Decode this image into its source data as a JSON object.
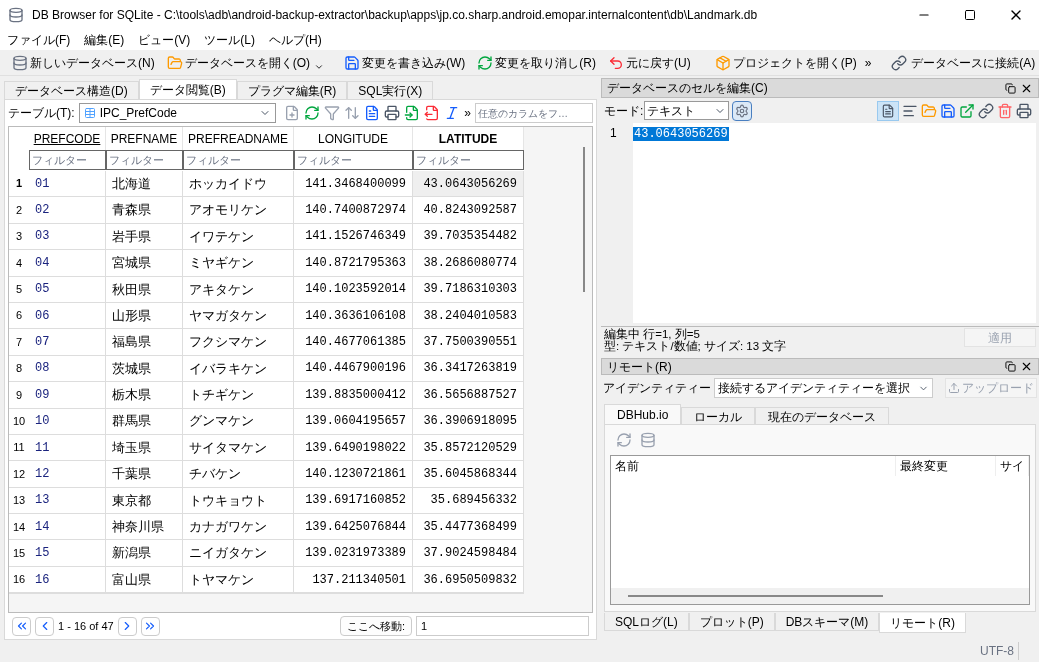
{
  "window": {
    "title": "DB Browser for SQLite - C:\\tools\\adb\\android-backup-extractor\\backup\\apps\\jp.co.sharp.android.emopar.internalcontent\\db\\Landmark.db"
  },
  "menu": [
    "ファイル(F)",
    "編集(E)",
    "ビュー(V)",
    "ツール(L)",
    "ヘルプ(H)"
  ],
  "toolbar": [
    {
      "label": "新しいデータベース(N)",
      "kind": "new"
    },
    {
      "label": "データベースを開く(O)",
      "kind": "open"
    },
    {
      "label": "変更を書き込み(W)",
      "kind": "write"
    },
    {
      "label": "変更を取り消し(R)",
      "kind": "revert"
    },
    {
      "label": "元に戻す(U)",
      "kind": "undo"
    },
    {
      "label": "プロジェクトを開く(P)",
      "kind": "project"
    }
  ],
  "toolbar_overflow": "»",
  "toolbar_connect": "データベースに接続(A)",
  "left_tabs": [
    {
      "label": "データベース構造(D)",
      "selected": false
    },
    {
      "label": "データ閲覧(B)",
      "selected": true
    },
    {
      "label": "プラグマ編集(R)",
      "selected": false
    },
    {
      "label": "SQL実行(X)",
      "selected": false
    }
  ],
  "table_toolbar": {
    "label": "テーブル(T):",
    "table": "IPC_PrefCode",
    "overflow": "»",
    "filter_placeholder": "任意のカラムをフ…"
  },
  "columns": [
    {
      "label": "PREFCODE",
      "sorted": true,
      "selected": false,
      "filter_placeholder": "フィルター"
    },
    {
      "label": "PREFNAME",
      "sorted": false,
      "selected": false,
      "filter_placeholder": "フィルター"
    },
    {
      "label": "PREFREADNAME",
      "sorted": false,
      "selected": false,
      "filter_placeholder": "フィルター"
    },
    {
      "label": "LONGITUDE",
      "sorted": false,
      "selected": false,
      "filter_placeholder": "フィルター"
    },
    {
      "label": "LATITUDE",
      "sorted": false,
      "selected": true,
      "filter_placeholder": "フィルター"
    }
  ],
  "rows": [
    {
      "index": "1",
      "selected": true,
      "cells": [
        "01",
        "北海道",
        "ホッカイドウ",
        "141.3468400099",
        "43.0643056269"
      ]
    },
    {
      "index": "2",
      "selected": false,
      "cells": [
        "02",
        "青森県",
        "アオモリケン",
        "140.7400872974",
        "40.8243092587"
      ]
    },
    {
      "index": "3",
      "selected": false,
      "cells": [
        "03",
        "岩手県",
        "イワテケン",
        "141.1526746349",
        "39.7035354482"
      ]
    },
    {
      "index": "4",
      "selected": false,
      "cells": [
        "04",
        "宮城県",
        "ミヤギケン",
        "140.8721795363",
        "38.2686080774"
      ]
    },
    {
      "index": "5",
      "selected": false,
      "cells": [
        "05",
        "秋田県",
        "アキタケン",
        "140.1023592014",
        "39.7186310303"
      ]
    },
    {
      "index": "6",
      "selected": false,
      "cells": [
        "06",
        "山形県",
        "ヤマガタケン",
        "140.3636106108",
        "38.2404010583"
      ]
    },
    {
      "index": "7",
      "selected": false,
      "cells": [
        "07",
        "福島県",
        "フクシマケン",
        "140.4677061385",
        "37.7500390551"
      ]
    },
    {
      "index": "8",
      "selected": false,
      "cells": [
        "08",
        "茨城県",
        "イバラキケン",
        "140.4467900196",
        "36.3417263819"
      ]
    },
    {
      "index": "9",
      "selected": false,
      "cells": [
        "09",
        "栃木県",
        "トチギケン",
        "139.8835000412",
        "36.5656887527"
      ]
    },
    {
      "index": "10",
      "selected": false,
      "cells": [
        "10",
        "群馬県",
        "グンマケン",
        "139.0604195657",
        "36.3906918095"
      ]
    },
    {
      "index": "11",
      "selected": false,
      "cells": [
        "11",
        "埼玉県",
        "サイタマケン",
        "139.6490198022",
        "35.8572120529"
      ]
    },
    {
      "index": "12",
      "selected": false,
      "cells": [
        "12",
        "千葉県",
        "チバケン",
        "140.1230721861",
        "35.6045868344"
      ]
    },
    {
      "index": "13",
      "selected": false,
      "cells": [
        "13",
        "東京都",
        "トウキョウト",
        "139.6917160852",
        "35.689456332"
      ]
    },
    {
      "index": "14",
      "selected": false,
      "cells": [
        "14",
        "神奈川県",
        "カナガワケン",
        "139.6425076844",
        "35.4477368499"
      ]
    },
    {
      "index": "15",
      "selected": false,
      "cells": [
        "15",
        "新潟県",
        "ニイガタケン",
        "139.0231973389",
        "37.9024598484"
      ]
    },
    {
      "index": "16",
      "selected": false,
      "cells": [
        "16",
        "富山県",
        "トヤマケン",
        "137.211340501",
        "36.6950509832"
      ]
    }
  ],
  "pager": {
    "range": "1 - 16 of 47",
    "goto_button": "ここへ移動:",
    "goto_value": "1"
  },
  "cell_editor": {
    "title": "データベースのセルを編集(C)",
    "mode_label": "モード:",
    "mode": "テキスト",
    "line_number": "1",
    "value": "43.0643056269",
    "status": [
      "編集中 行=1, 列=5",
      "型: テキスト/数値; サイズ: 13 文字"
    ],
    "apply": {
      "label": "適用",
      "disabled": true
    }
  },
  "remote": {
    "title": "リモート(R)",
    "identity_label": "アイデンティティー",
    "identity": "接続するアイデンティティーを選択",
    "upload": {
      "label": "アップロード",
      "disabled": true
    },
    "tabs": [
      {
        "label": "DBHub.io",
        "selected": true
      },
      {
        "label": "ローカル",
        "selected": false
      },
      {
        "label": "現在のデータベース",
        "selected": false
      }
    ],
    "columns": [
      "名前",
      "最終変更",
      "サイ"
    ]
  },
  "bottom_tabs": [
    {
      "label": "SQLログ(L)",
      "selected": false
    },
    {
      "label": "プロット(P)",
      "selected": false
    },
    {
      "label": "DBスキーマ(M)",
      "selected": false
    },
    {
      "label": "リモート(R)",
      "selected": true
    }
  ],
  "status_bar": {
    "encoding": "UTF-8"
  }
}
